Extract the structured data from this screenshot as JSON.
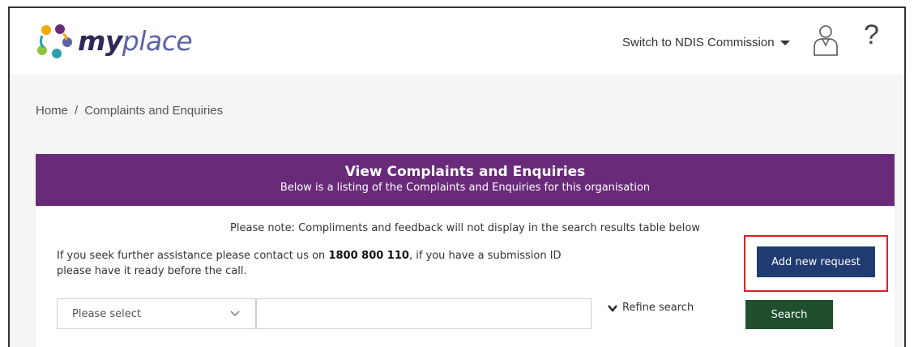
{
  "header": {
    "logo_my": "my",
    "logo_place": "place",
    "switch_label": "Switch to NDIS Commission",
    "help_glyph": "?"
  },
  "breadcrumb": {
    "home": "Home",
    "separator": "/",
    "current": "Complaints and Enquiries"
  },
  "panel": {
    "title": "View Complaints and Enquiries",
    "subtitle": "Below is a listing of the Complaints and Enquiries for this organisation",
    "note": "Please note: Compliments and feedback will not display in the search results table below",
    "assist_prefix": "If you seek further assistance please contact us on ",
    "assist_phone": "1800 800 110",
    "assist_suffix": ", if you have a submission ID",
    "assist_line2": "please have it ready before the call.",
    "add_button": "Add new request"
  },
  "search": {
    "select_value": "Please select",
    "input_value": "",
    "refine_label": "Refine search",
    "search_button": "Search"
  },
  "colors": {
    "panel_header": "#6a2a7a",
    "add_button": "#1f3b70",
    "search_button": "#1f4f2f",
    "highlight_frame": "#d62027"
  },
  "icons": {
    "logo": "myplace-logo-icon",
    "switch_caret": "caret-down-icon",
    "user": "user-icon",
    "help": "help-icon",
    "select_chevron": "chevron-down-icon",
    "refine_chevron": "chevron-down-icon"
  }
}
